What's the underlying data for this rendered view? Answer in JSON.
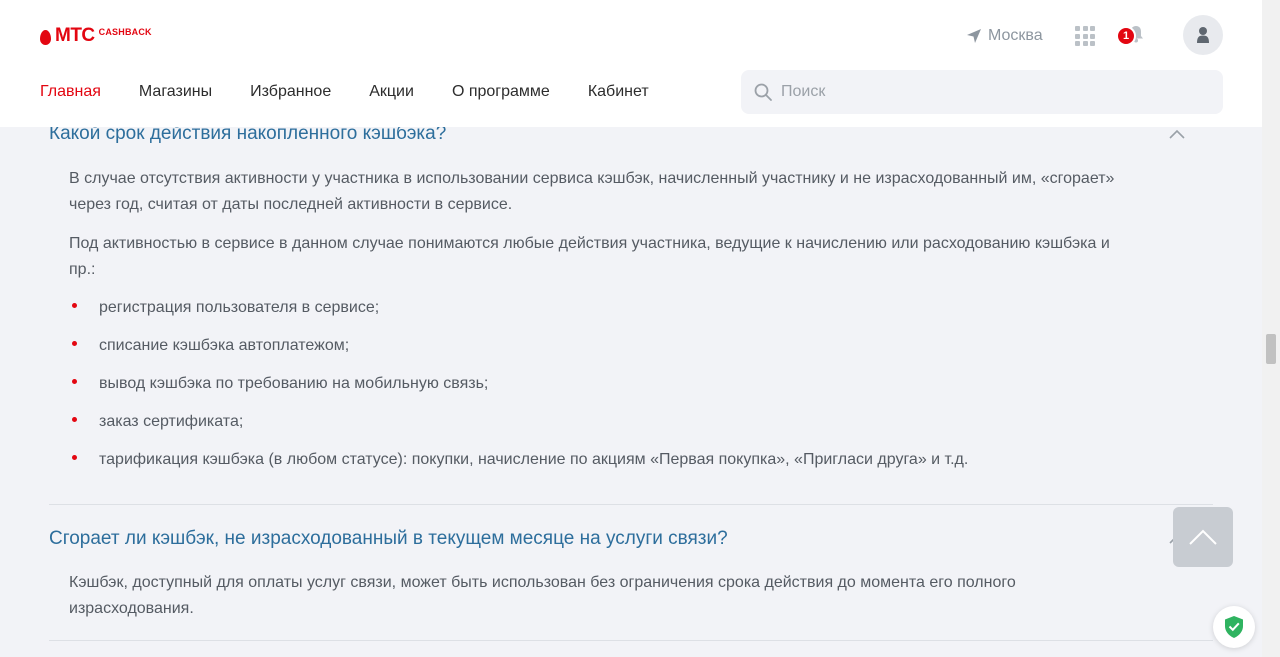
{
  "brand": {
    "name": "МТС",
    "sub": "CASHBACK",
    "color": "#e30611"
  },
  "header": {
    "city": "Москва",
    "notifications_count": "1",
    "nav": [
      {
        "label": "Главная",
        "active": true
      },
      {
        "label": "Магазины",
        "active": false
      },
      {
        "label": "Избранное",
        "active": false
      },
      {
        "label": "Акции",
        "active": false
      },
      {
        "label": "О программе",
        "active": false
      },
      {
        "label": "Кабинет",
        "active": false
      }
    ],
    "search": {
      "placeholder": "Поиск",
      "value": ""
    }
  },
  "faq": [
    {
      "question": "Какой срок действия накопленного кэшбэка?",
      "paragraphs": [
        "В случае отсутствия активности у участника в использовании сервиса кэшбэк, начисленный участнику и не израсходованный им, «сгорает» через год, считая от даты последней активности в сервисе.",
        "Под активностью в сервисе в данном случае понимаются любые действия участника, ведущие к начислению или расходованию кэшбэка и пр.:"
      ],
      "bullets": [
        "регистрация пользователя в сервисе;",
        "списание кэшбэка автоплатежом;",
        "вывод кэшбэка по требованию на мобильную связь;",
        "заказ сертификата;",
        "тарификация кэшбэка (в любом статусе): покупки, начисление по акциям «Первая покупка», «Пригласи друга» и т.д."
      ]
    },
    {
      "question": "Сгорает ли кэшбэк, не израсходованный в текущем месяце на услуги связи?",
      "paragraphs": [
        "Кэшбэк, доступный для оплаты услуг связи, может быть использован без ограничения срока действия до момента его полного израсходования."
      ]
    }
  ],
  "icons": {
    "location": "location-arrow-icon",
    "apps": "apps-grid-icon",
    "bell": "bell-icon",
    "avatar": "user-icon",
    "search": "search-icon",
    "chevron": "chevron-up-icon",
    "to_top": "arrow-up-icon",
    "shield": "shield-check-icon"
  },
  "colors": {
    "link": "#2d6e9c",
    "accent": "#e30611",
    "background": "#f2f3f7",
    "shield": "#2fb360"
  }
}
